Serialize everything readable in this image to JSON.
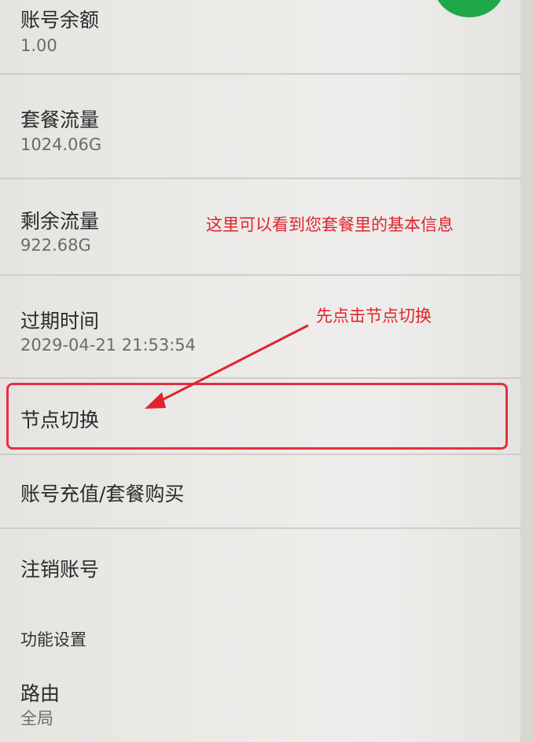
{
  "account": {
    "balance_label": "账号余额",
    "balance_value": "1.00",
    "plan_traffic_label": "套餐流量",
    "plan_traffic_value": "1024.06G",
    "remaining_traffic_label": "剩余流量",
    "remaining_traffic_value": "922.68G",
    "expiry_label": "过期时间",
    "expiry_value": "2029-04-21 21:53:54"
  },
  "actions": {
    "node_switch": "节点切换",
    "recharge_purchase": "账号充值/套餐购买",
    "logout": "注销账号"
  },
  "settings": {
    "header": "功能设置",
    "route_label": "路由",
    "route_value": "全局"
  },
  "annotations": {
    "info_note": "这里可以看到您套餐里的基本信息",
    "click_note": "先点击节点切换"
  },
  "colors": {
    "annotation": "#e0242e",
    "fab": "#1fa84a",
    "background": "#ebeae7"
  }
}
